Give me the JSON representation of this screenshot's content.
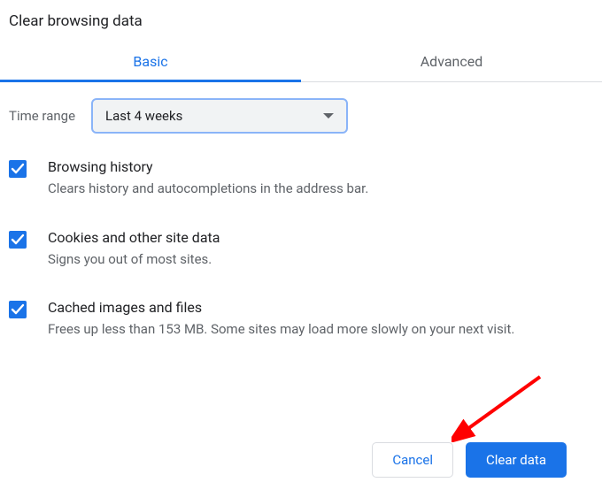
{
  "title": "Clear browsing data",
  "tabs": {
    "basic": "Basic",
    "advanced": "Advanced"
  },
  "range": {
    "label": "Time range",
    "selected": "Last 4 weeks"
  },
  "options": [
    {
      "title": "Browsing history",
      "desc": "Clears history and autocompletions in the address bar."
    },
    {
      "title": "Cookies and other site data",
      "desc": "Signs you out of most sites."
    },
    {
      "title": "Cached images and files",
      "desc": "Frees up less than 153 MB. Some sites may load more slowly on your next visit."
    }
  ],
  "buttons": {
    "cancel": "Cancel",
    "clear": "Clear data"
  }
}
